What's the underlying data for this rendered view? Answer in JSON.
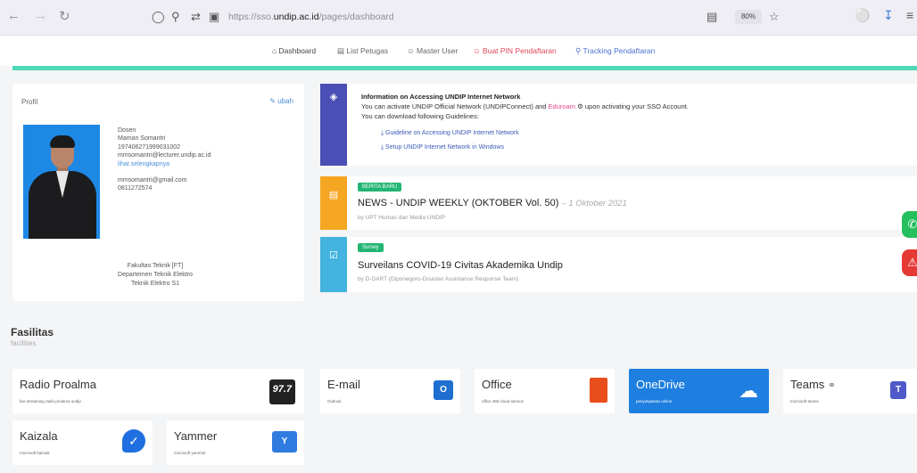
{
  "browser": {
    "url_prefix": "https://sso.",
    "url_domain": "undip.ac.id",
    "url_path": "/pages/dashboard",
    "zoom": "80%"
  },
  "nav": {
    "items": [
      {
        "label": "Dashboard",
        "icon": "home-icon"
      },
      {
        "label": "List Petugas",
        "icon": "list-icon"
      },
      {
        "label": "Master User",
        "icon": "user-icon"
      },
      {
        "label": "Buat PIN Pendaftaran",
        "icon": "user-add-icon"
      },
      {
        "label": "Tracking Pendaftaran",
        "icon": "search-icon"
      }
    ]
  },
  "profile": {
    "title": "Profil",
    "edit_label": "ubah",
    "role": "Dosen",
    "name": "Maman Somantri",
    "nip": "197406271999031002",
    "email_undip": "mmsomantri@lecturer.undip.ac.id",
    "link_label": "lihat selengkapnya",
    "email_personal": "mmsomantri@gmail.com",
    "phone": "0811272574",
    "faculty": "Fakultas Teknik [FT]",
    "department": "Departemen Teknik Elektro",
    "program": "Teknik Elektro S1"
  },
  "info": {
    "heading": "Information on Accessing UNDIP Internet Network",
    "line1_pre": "You can activate UNDIP Official Network (UNDIPConnect) and ",
    "line1_highlight": "Eduroam",
    "line1_post": " upon activating your SSO Account.",
    "line2": "You can download following Guidelines:",
    "guide1": "Guideline on Accessing UNDIP Internet Network",
    "guide2": "Setup UNDIP Internet Network in Windows"
  },
  "news": {
    "badge": "BERITA BARU",
    "title": "NEWS - UNDIP WEEKLY (OKTOBER Vol. 50)",
    "date": "1 Oktober 2021",
    "by": "by UPT Humas dan Media UNDIP"
  },
  "survey": {
    "badge": "Survey",
    "title": "Surveilans COVID-19 Civitas Akademika Undip",
    "by": "by D-DART (Diponegoro-Disaster Assistance Response Team)"
  },
  "fasilitas": {
    "title": "Fasilitas",
    "subtitle": "facilities",
    "tiles": [
      {
        "name": "Radio Proalma",
        "desc": "live streaming radio proalma undip",
        "logo": "97.7"
      },
      {
        "name": "E-mail",
        "desc": "Outlook",
        "logo": "outlook-icon"
      },
      {
        "name": "Office",
        "desc": "office 365 cloud service",
        "logo": "office-icon"
      },
      {
        "name": "OneDrive",
        "desc": "penyimpanan online",
        "logo": "cloud-icon"
      },
      {
        "name": "Teams",
        "desc": "microsoft teams",
        "logo": "teams-icon"
      },
      {
        "name": "Kaizala",
        "desc": "microsoft kaizala",
        "logo": "kaizala-icon"
      },
      {
        "name": "Yammer",
        "desc": "microsoft yammer",
        "logo": "yammer-icon"
      }
    ]
  },
  "colors": {
    "accent_green": "#4fd8b8",
    "info_strip": "#4a4fb5",
    "news_strip": "#f5a623",
    "survey_strip": "#43b3df",
    "onedrive_blue": "#1f7fe0"
  }
}
